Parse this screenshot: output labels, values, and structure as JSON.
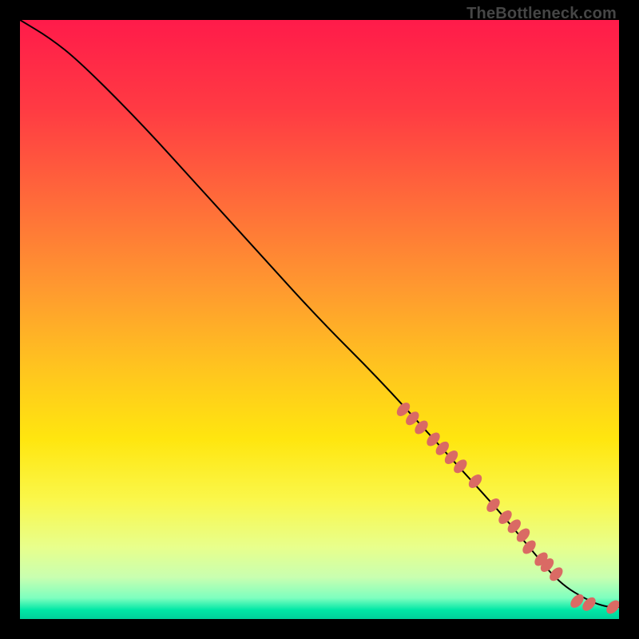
{
  "attribution": "TheBottleneck.com",
  "colors": {
    "curve_stroke": "#000000",
    "marker_fill": "#da6a64",
    "marker_stroke": "#b24e49",
    "gradient_stops": [
      {
        "offset": 0.0,
        "color": "#ff1b4a"
      },
      {
        "offset": 0.15,
        "color": "#ff3b43"
      },
      {
        "offset": 0.3,
        "color": "#ff6a3a"
      },
      {
        "offset": 0.45,
        "color": "#ff9a2f"
      },
      {
        "offset": 0.58,
        "color": "#ffc41f"
      },
      {
        "offset": 0.7,
        "color": "#ffe60f"
      },
      {
        "offset": 0.8,
        "color": "#faf74a"
      },
      {
        "offset": 0.88,
        "color": "#e8ff8c"
      },
      {
        "offset": 0.93,
        "color": "#c9ffb0"
      },
      {
        "offset": 0.965,
        "color": "#7dffbf"
      },
      {
        "offset": 0.985,
        "color": "#00e7a6"
      },
      {
        "offset": 1.0,
        "color": "#00d19a"
      }
    ]
  },
  "chart_data": {
    "type": "line",
    "title": "",
    "xlabel": "",
    "ylabel": "",
    "xlim": [
      0,
      100
    ],
    "ylim": [
      0,
      100
    ],
    "grid": false,
    "legend": false,
    "series": [
      {
        "name": "bottleneck-curve",
        "kind": "line",
        "x": [
          0,
          5,
          10,
          20,
          30,
          40,
          50,
          60,
          70,
          80,
          85,
          90,
          95,
          98,
          100
        ],
        "y": [
          100,
          97,
          93,
          83,
          72,
          61,
          50,
          40,
          29,
          18,
          12,
          6,
          3,
          2,
          2
        ]
      },
      {
        "name": "tail-cluster-points",
        "kind": "scatter",
        "x": [
          64,
          65.5,
          67,
          69,
          70.5,
          72,
          73.5,
          76,
          79,
          81,
          82.5,
          84,
          85,
          87,
          88,
          89.5,
          93,
          95,
          99
        ],
        "y": [
          35,
          33.5,
          32,
          30,
          28.5,
          27,
          25.5,
          23,
          19,
          17,
          15.5,
          14,
          12,
          10,
          9,
          7.5,
          3,
          2.5,
          2
        ]
      }
    ]
  }
}
